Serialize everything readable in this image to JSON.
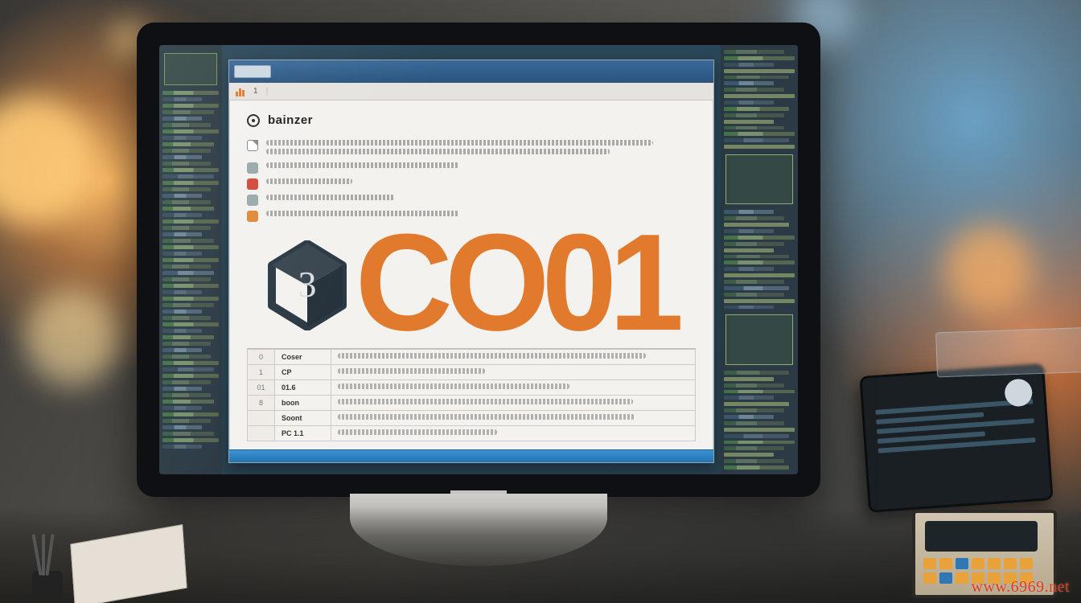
{
  "watermark": "www.6969.net",
  "appwin": {
    "title_heading": "bainzer",
    "tabs": {
      "item1": "1"
    },
    "paragraphs": [
      "",
      "",
      "",
      "",
      ""
    ],
    "hero_logo_text": "CO01",
    "table": {
      "rows": [
        {
          "num": "0",
          "key": "Coser",
          "val": ""
        },
        {
          "num": "1",
          "key": "CP",
          "val": ""
        },
        {
          "num": "01",
          "key": "01.6",
          "val": ""
        },
        {
          "num": "8",
          "key": "boon",
          "val": ""
        },
        {
          "num": "",
          "key": "Soont",
          "val": ""
        },
        {
          "num": "",
          "key": "PC 1.1",
          "val": ""
        }
      ]
    }
  },
  "colors": {
    "accent_orange": "#e27a2e",
    "titlebar_blue": "#2a547e"
  }
}
